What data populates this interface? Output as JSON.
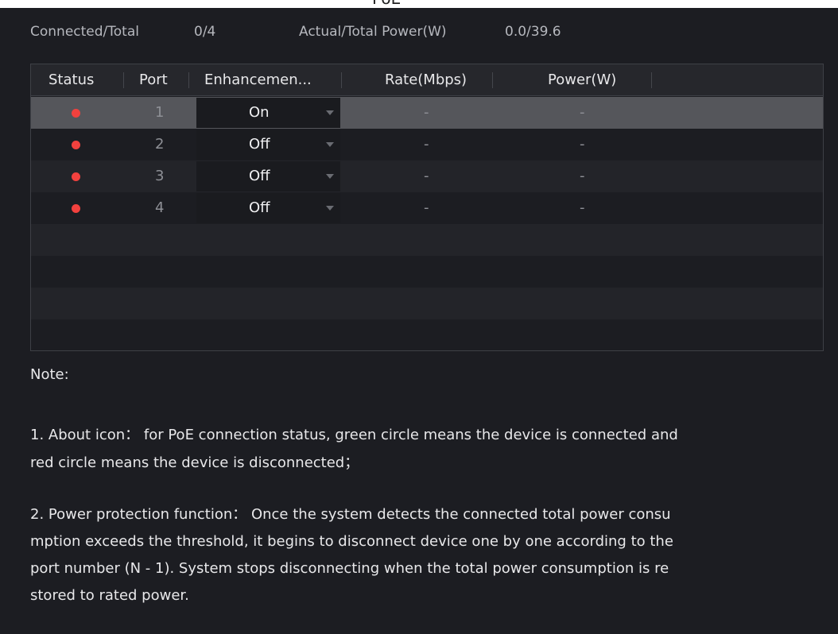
{
  "dialog": {
    "title": "PoE"
  },
  "summary": {
    "connected_label": "Connected/Total",
    "connected_value": "0/4",
    "power_label": "Actual/Total Power(W)",
    "power_value": "0.0/39.6"
  },
  "table": {
    "headers": [
      "Status",
      "Port",
      "Enhancemen...",
      "Rate(Mbps)",
      "Power(W)"
    ],
    "rows": [
      {
        "status": "disconnected",
        "status_color": "#f2413e",
        "port": "1",
        "enhancement": "On",
        "rate": "-",
        "power": "-"
      },
      {
        "status": "disconnected",
        "status_color": "#f2413e",
        "port": "2",
        "enhancement": "Off",
        "rate": "-",
        "power": "-"
      },
      {
        "status": "disconnected",
        "status_color": "#f2413e",
        "port": "3",
        "enhancement": "Off",
        "rate": "-",
        "power": "-"
      },
      {
        "status": "disconnected",
        "status_color": "#f2413e",
        "port": "4",
        "enhancement": "Off",
        "rate": "-",
        "power": "-"
      }
    ]
  },
  "notes": {
    "heading": "Note:",
    "line1a": "1. About icon： for PoE connection status, green circle means the device is connected and",
    "line1b": " red circle means the device is disconnected；",
    "line2a": "2. Power protection function： Once the system detects the connected total power consu",
    "line2b": "mption exceeds the threshold, it begins to disconnect device one by one according to the",
    "line2c": " port number (N - 1). System stops disconnecting when the total power consumption is re",
    "line2d": "stored to rated power."
  },
  "colors": {
    "background": "#1c1d22",
    "selected_row": "#55565b",
    "status_disconnected": "#f2413e"
  }
}
